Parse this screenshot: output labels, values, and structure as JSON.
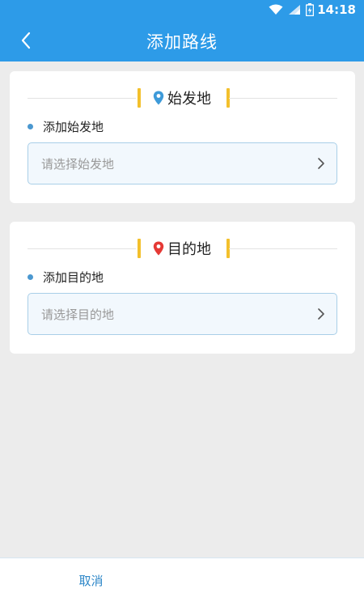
{
  "status_bar": {
    "time": "14:18",
    "icons": [
      "wifi-icon",
      "signal-icon",
      "battery-charging-icon"
    ]
  },
  "header": {
    "title": "添加路线",
    "back_icon": "chevron-left-icon"
  },
  "origin": {
    "heading": "始发地",
    "label": "添加始发地",
    "placeholder": "请选择始发地",
    "pin_color": "#3d9ad9"
  },
  "destination": {
    "heading": "目的地",
    "label": "添加目的地",
    "placeholder": "请选择目的地",
    "pin_color": "#e53935"
  },
  "footer": {
    "cancel_label": "取消"
  },
  "colors": {
    "primary": "#2d9be8",
    "accent_bar": "#f3c02c",
    "link": "#2d87c8"
  }
}
